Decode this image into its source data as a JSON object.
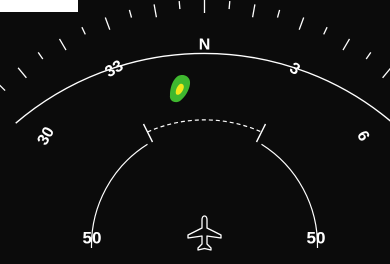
{
  "compass": {
    "headings": [
      {
        "label": "30",
        "bearing": 300
      },
      {
        "label": "33",
        "bearing": 330
      },
      {
        "label": "N",
        "bearing": 0
      },
      {
        "label": "3",
        "bearing": 30
      },
      {
        "label": "6",
        "bearing": 60
      }
    ]
  },
  "range": {
    "left_label": "50",
    "right_label": "50"
  },
  "weather": {
    "outer_color": "#3fb82f",
    "inner_color": "#f2e81a"
  },
  "colors": {
    "background": "#0b0b0b",
    "foreground": "#ffffff"
  },
  "icons": {
    "ownship": "aircraft-icon"
  }
}
